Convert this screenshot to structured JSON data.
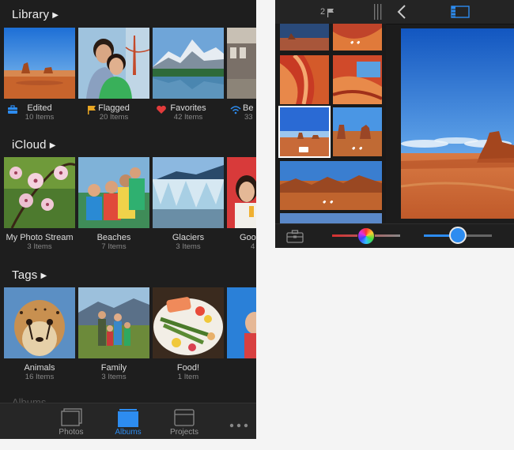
{
  "library": {
    "title": "Library",
    "items": [
      {
        "label": "Edited",
        "count": "10 Items",
        "icon": "toolbox-icon"
      },
      {
        "label": "Flagged",
        "count": "20 Items",
        "icon": "flag-icon"
      },
      {
        "label": "Favorites",
        "count": "42 Items",
        "icon": "heart-icon"
      },
      {
        "label": "Be",
        "count": "33",
        "icon": "wifi-icon"
      }
    ]
  },
  "icloud": {
    "title": "iCloud",
    "items": [
      {
        "label": "My Photo Stream",
        "count": "3 Items"
      },
      {
        "label": "Beaches",
        "count": "7 Items"
      },
      {
        "label": "Glaciers",
        "count": "3 Items"
      },
      {
        "label": "Good",
        "count": "4"
      }
    ]
  },
  "tags": {
    "title": "Tags",
    "items": [
      {
        "label": "Animals",
        "count": "16 Items"
      },
      {
        "label": "Family",
        "count": "3 Items"
      },
      {
        "label": "Food!",
        "count": "1 Item"
      },
      {
        "label": "",
        "count": ""
      }
    ]
  },
  "albums_peek": "Albums",
  "tabbar": {
    "tabs": [
      {
        "label": "Photos",
        "icon": "photos-icon"
      },
      {
        "label": "Albums",
        "icon": "albums-icon",
        "active": true
      },
      {
        "label": "Projects",
        "icon": "projects-icon"
      },
      {
        "label": "",
        "icon": "more-icon"
      }
    ]
  },
  "editor": {
    "flag_count": "2",
    "hue_slider_value": 0.38,
    "brightness_slider_value": 0.49
  },
  "colors": {
    "accent": "#2d8cf0",
    "panel_bg": "#1e1e1e",
    "flag": "#e8a623",
    "heart": "#e23b3b"
  }
}
